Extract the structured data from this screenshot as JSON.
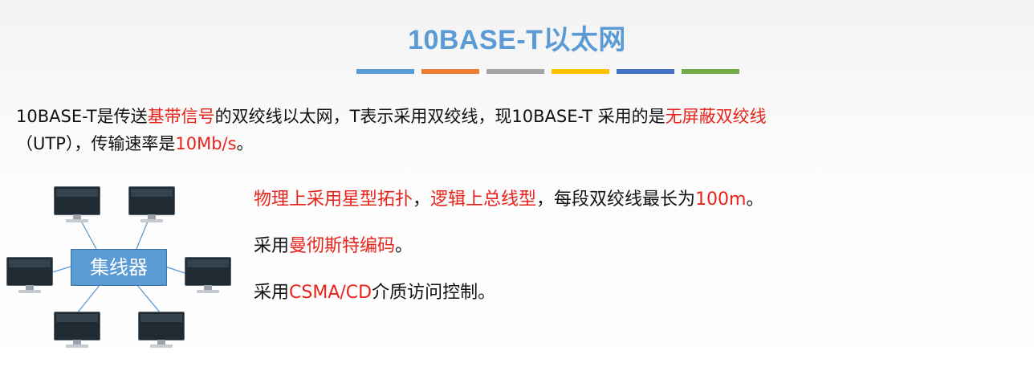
{
  "slide": {
    "title_prefix": "10BASE-T",
    "title_suffix": "以太网",
    "accent_bars": [
      "#5b9bd5",
      "#ed7d31",
      "#a5a5a5",
      "#ffc000",
      "#4472c4",
      "#70ad47"
    ]
  },
  "intro": {
    "p1": "10BASE-T是传送",
    "r1": "基带信号",
    "p2": "的双绞线以太网，T表示采用双绞线，现10BASE-T 采用的是",
    "r2": "无屏蔽双绞线",
    "p3": "（UTP），传输速率是",
    "r3": "10Mb/s",
    "p4": "。"
  },
  "points": [
    {
      "r1": "物理上采用星型拓扑",
      "t1": "，",
      "r2": "逻辑上总线型",
      "t2": "，每段双绞线最长为",
      "r3": "100m",
      "t3": "。"
    },
    {
      "t1": "采用",
      "r1": "曼彻斯特编码",
      "t2": "。"
    },
    {
      "t1": "采用",
      "r1": "CSMA/CD",
      "t2": "介质访问控制。"
    }
  ],
  "diagram": {
    "hub_label": "集线器",
    "computer_icons": [
      "computer-icon",
      "computer-icon",
      "computer-icon",
      "computer-icon",
      "computer-icon",
      "computer-icon"
    ]
  },
  "colors": {
    "title": "#5b9bd5",
    "highlight": "#e8231b",
    "hub": "#5b9bd5",
    "link": "#5b9bd5"
  }
}
